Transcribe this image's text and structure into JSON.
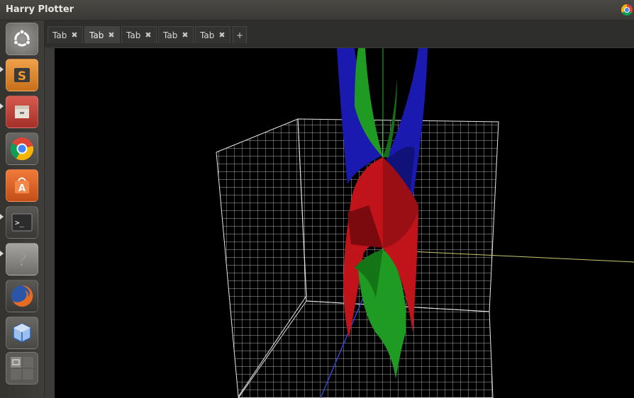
{
  "window": {
    "title": "Harry Plotter"
  },
  "launcher": {
    "items": [
      {
        "name": "ubuntu-dash-icon",
        "color": "#8c8a86"
      },
      {
        "name": "sublime-text-icon",
        "color": "#e58b2c",
        "glyph": "S"
      },
      {
        "name": "file-manager-icon",
        "color": "#c9463d"
      },
      {
        "name": "chrome-icon",
        "color": "#4285f4"
      },
      {
        "name": "software-center-icon",
        "color": "#e8692b",
        "glyph": "A"
      },
      {
        "name": "terminal-icon",
        "color": "#2c2c2c",
        "glyph": ">_"
      },
      {
        "name": "help-icon",
        "color": "#8a8a86",
        "glyph": "?"
      },
      {
        "name": "firefox-icon",
        "color": "#e76b20"
      },
      {
        "name": "virtualbox-icon",
        "color": "#5b8fd6"
      },
      {
        "name": "workspace-switcher-icon",
        "color": "#7a7873"
      }
    ]
  },
  "tabs": {
    "items": [
      {
        "label": "Tab",
        "close": "✖"
      },
      {
        "label": "Tab",
        "close": "✖",
        "active": true
      },
      {
        "label": "Tab",
        "close": "✖"
      },
      {
        "label": "Tab",
        "close": "✖"
      },
      {
        "label": "Tab",
        "close": "✖"
      }
    ],
    "add_label": "+"
  },
  "plot": {
    "surface_colors": {
      "red": "#c0141a",
      "green": "#1f9a22",
      "blue": "#1a1ab0"
    },
    "grid_color": "#e6e6e6",
    "axis_colors": {
      "x": "#c8c86a",
      "y": "#21b821",
      "z": "#3344cc"
    }
  }
}
